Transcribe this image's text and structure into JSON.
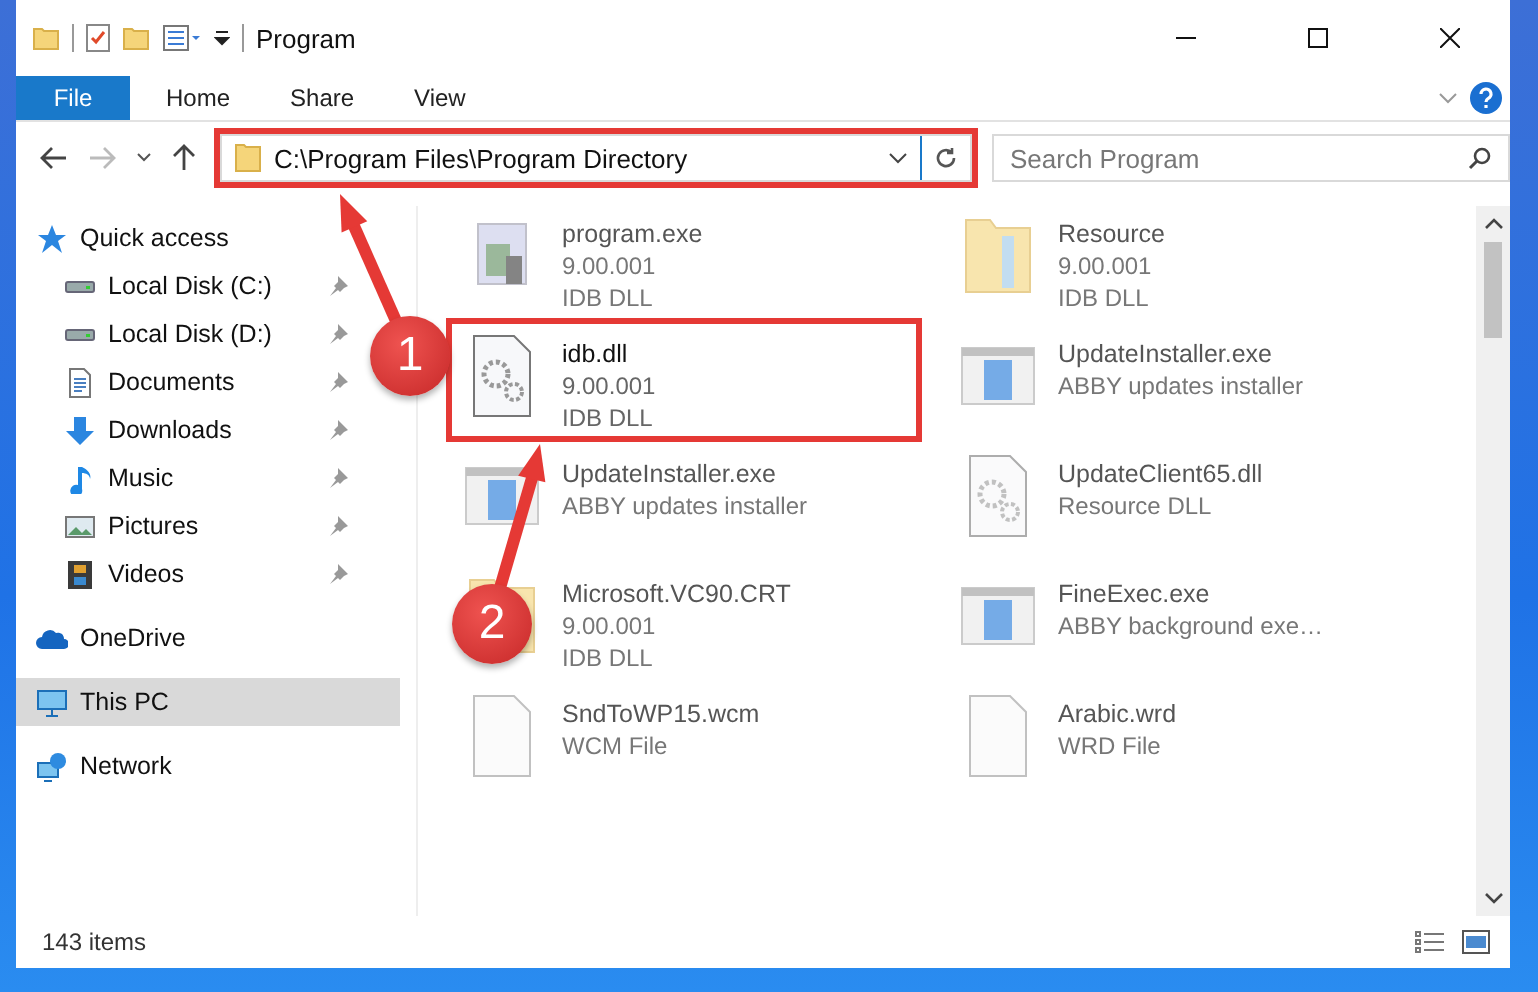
{
  "window": {
    "title": "Program"
  },
  "ribbon": {
    "tabs": [
      {
        "label": "File",
        "kind": "file"
      },
      {
        "label": "Home",
        "kind": "tab"
      },
      {
        "label": "Share",
        "kind": "tab"
      },
      {
        "label": "View",
        "kind": "tab"
      }
    ]
  },
  "address": {
    "path": "C:\\Program Files\\Program Directory"
  },
  "search": {
    "placeholder": "Search Program"
  },
  "nav": [
    {
      "label": "Quick access",
      "selected": false,
      "children": [
        {
          "label": "Local Disk (C:)",
          "pinned": true
        },
        {
          "label": "Local Disk (D:)",
          "pinned": true
        },
        {
          "label": "Documents",
          "pinned": true
        },
        {
          "label": "Downloads",
          "pinned": true
        },
        {
          "label": "Music",
          "pinned": true
        },
        {
          "label": "Pictures",
          "pinned": true
        },
        {
          "label": "Videos",
          "pinned": true
        }
      ]
    },
    {
      "label": "OneDrive",
      "selected": false
    },
    {
      "label": "This PC",
      "selected": true
    },
    {
      "label": "Network",
      "selected": false
    }
  ],
  "files": [
    {
      "name": "program.exe",
      "details": [
        "9.00.001",
        "IDB DLL"
      ],
      "blurred": true
    },
    {
      "name": "Resource",
      "details": [
        "9.00.001",
        "IDB DLL"
      ],
      "blurred": true
    },
    {
      "name": "idb.dll",
      "details": [
        "9.00.001",
        "IDB DLL"
      ],
      "blurred": false
    },
    {
      "name": "UpdateInstaller.exe",
      "details": [
        "ABBY updates installer"
      ],
      "blurred": true
    },
    {
      "name": "UpdateInstaller.exe",
      "details": [
        "ABBY updates installer"
      ],
      "blurred": true
    },
    {
      "name": "UpdateClient65.dll",
      "details": [
        "Resource DLL"
      ],
      "blurred": true
    },
    {
      "name": "Microsoft.VC90.CRT",
      "details": [
        "9.00.001",
        "IDB DLL"
      ],
      "blurred": true
    },
    {
      "name": "FineExec.exe",
      "details": [
        "ABBY background exe…"
      ],
      "blurred": true
    },
    {
      "name": "SndToWP15.wcm",
      "details": [
        "WCM File"
      ],
      "blurred": true
    },
    {
      "name": "Arabic.wrd",
      "details": [
        "WRD File"
      ],
      "blurred": true
    }
  ],
  "status_bar": {
    "count": "143 items"
  },
  "annotations": [
    {
      "number": "1"
    },
    {
      "number": "2"
    }
  ]
}
